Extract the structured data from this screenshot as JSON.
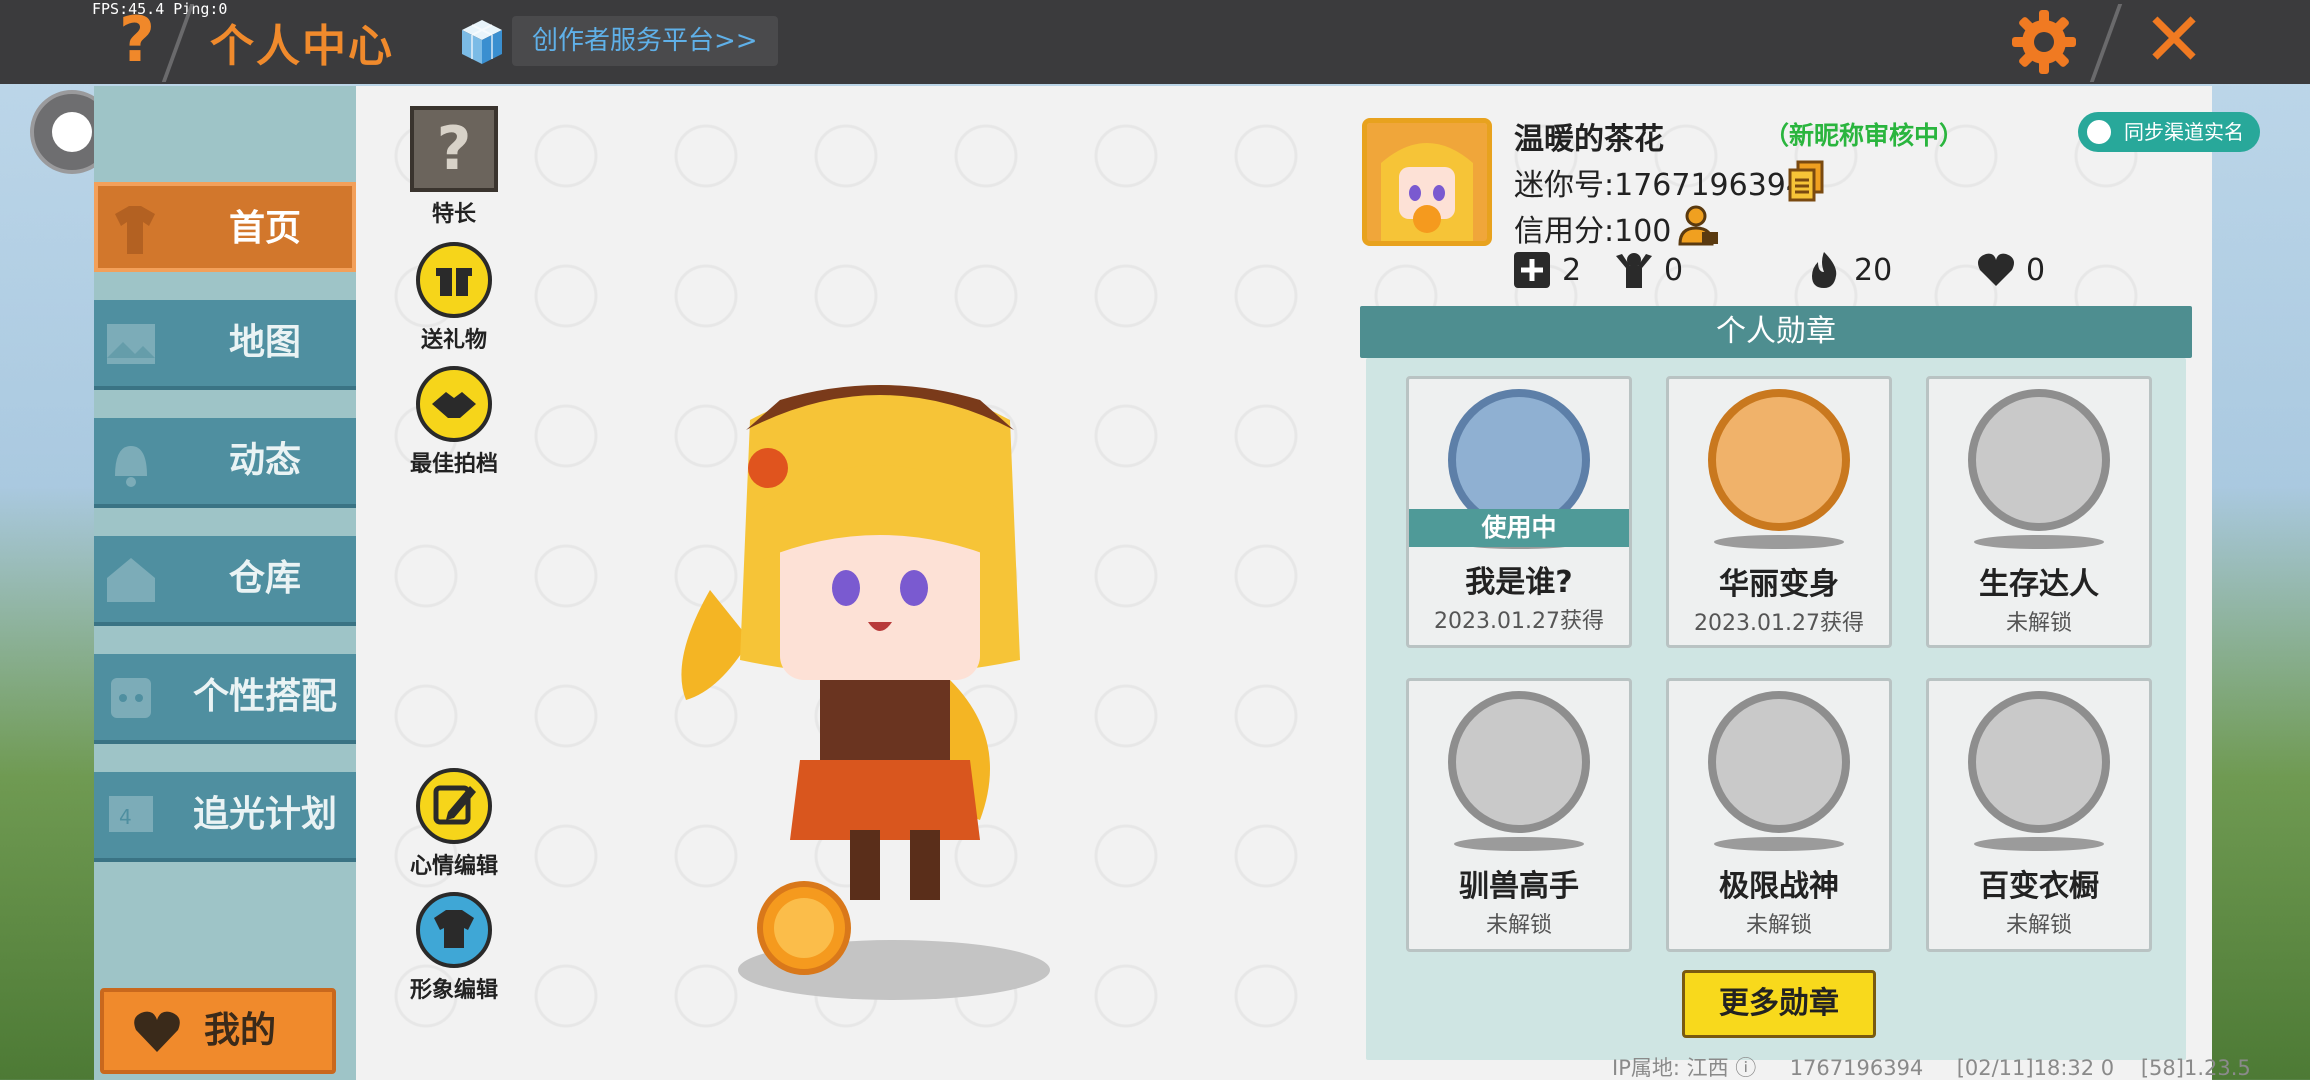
{
  "overlay": {
    "fps": "FPS:45.4  Ping:0"
  },
  "header": {
    "title": "个人中心",
    "creator_link": "创作者服务平台>>"
  },
  "sidebar": {
    "items": [
      {
        "label": "首页",
        "active": true
      },
      {
        "label": "地图",
        "active": false
      },
      {
        "label": "动态",
        "active": false
      },
      {
        "label": "仓库",
        "active": false
      },
      {
        "label": "个性搭配",
        "active": false
      },
      {
        "label": "追光计划",
        "active": false
      }
    ],
    "mine": "我的"
  },
  "tools": {
    "specialty": "特长",
    "gift": "送礼物",
    "partner": "最佳拍档",
    "mood": "心情编辑",
    "image": "形象编辑"
  },
  "profile": {
    "name": "温暖的茶花",
    "nickname_status": "（新昵称审核中）",
    "mini_id": "迷你号:1767196394",
    "credit": "信用分:100",
    "sync_button": "同步渠道实名",
    "stats": {
      "friends": "2",
      "fans": "0",
      "hot": "20",
      "likes": "0"
    }
  },
  "medals": {
    "header": "个人勋章",
    "items": [
      {
        "name": "我是谁?",
        "sub": "2023.01.27获得",
        "in_use": "使用中"
      },
      {
        "name": "华丽变身",
        "sub": "2023.01.27获得"
      },
      {
        "name": "生存达人",
        "sub": "未解锁"
      },
      {
        "name": "驯兽高手",
        "sub": "未解锁"
      },
      {
        "name": "极限战神",
        "sub": "未解锁"
      },
      {
        "name": "百变衣橱",
        "sub": "未解锁"
      }
    ],
    "more_button": "更多勋章"
  },
  "footer": {
    "ip": "IP属地: 江西",
    "uid": "1767196394",
    "time": "[02/11]18:32 0",
    "version": "[58]1.23.5"
  },
  "colors": {
    "accent": "#f08a2c",
    "teal": "#4f8fa0",
    "medal_header": "#4e8e90",
    "more_button": "#f8d91c"
  }
}
